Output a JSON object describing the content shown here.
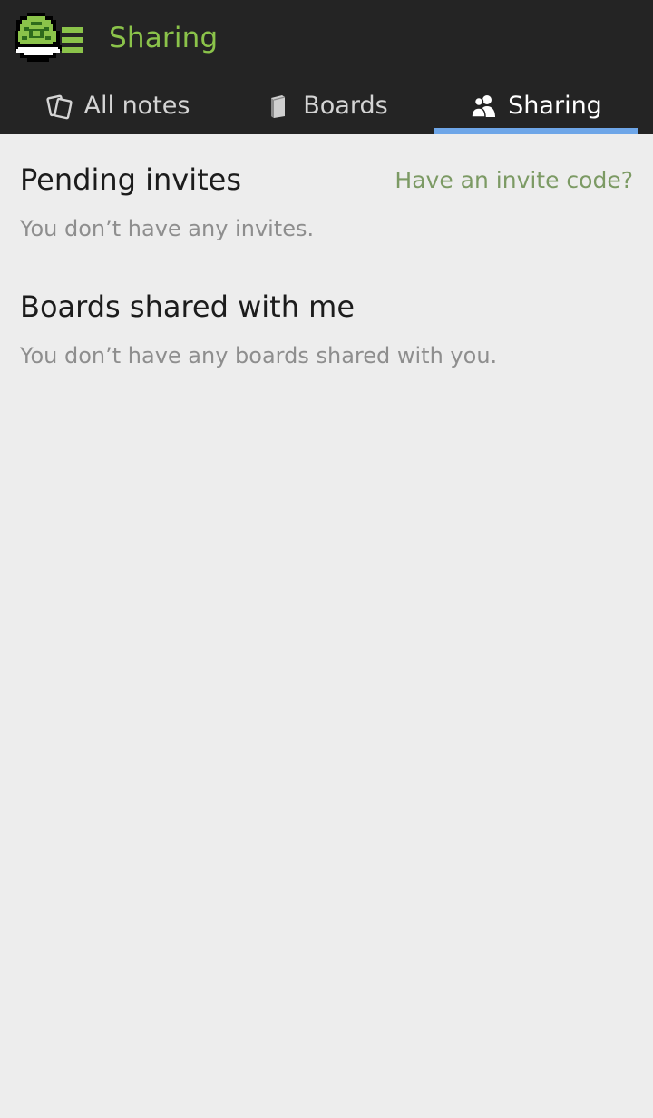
{
  "appbar": {
    "title": "Sharing",
    "logo_icon": "turtle-shell-menu-icon"
  },
  "tabs": [
    {
      "label": "All notes",
      "icon": "notes-icon",
      "active": false
    },
    {
      "label": "Boards",
      "icon": "board-icon",
      "active": false
    },
    {
      "label": "Sharing",
      "icon": "people-icon",
      "active": true
    }
  ],
  "invites": {
    "heading": "Pending invites",
    "invite_code_link": "Have an invite code?",
    "empty_message": "You don’t have any invites."
  },
  "shared": {
    "heading": "Boards shared with me",
    "empty_message": "You don’t have any boards shared with you."
  },
  "colors": {
    "appbar_bg": "#242424",
    "title_green": "#8bc34a",
    "tab_indicator": "#6ea6e8",
    "link_green": "#7c9a64",
    "page_bg": "#ededed"
  }
}
